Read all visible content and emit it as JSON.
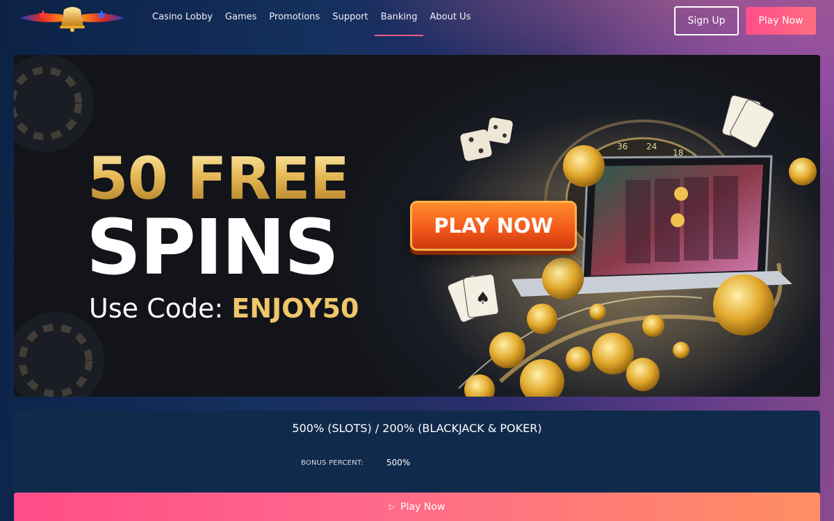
{
  "nav": {
    "items": [
      {
        "label": "Casino Lobby"
      },
      {
        "label": "Games"
      },
      {
        "label": "Promotions"
      },
      {
        "label": "Support"
      },
      {
        "label": "Banking",
        "active": true
      },
      {
        "label": "About Us"
      }
    ]
  },
  "header": {
    "signup_label": "Sign Up",
    "playnow_label": "Play Now"
  },
  "banner": {
    "line1": "50 FREE",
    "line2": "SPINS",
    "code_label": "Use Code: ",
    "code_value": "ENJOY50",
    "cta_label": "PLAY NOW"
  },
  "bonus": {
    "title": "500% (SLOTS) / 200% (BLACKJACK & POKER)",
    "label": "BONUS PERCENT:",
    "value": "500%"
  },
  "footer_cta": {
    "icon": "play-triangle-icon",
    "label": "Play Now"
  },
  "colors": {
    "accent_pink": "#ff4d8a",
    "accent_orange": "#ff8e62",
    "gold": "#f0c66a",
    "panel_bg": "#102a4c"
  }
}
